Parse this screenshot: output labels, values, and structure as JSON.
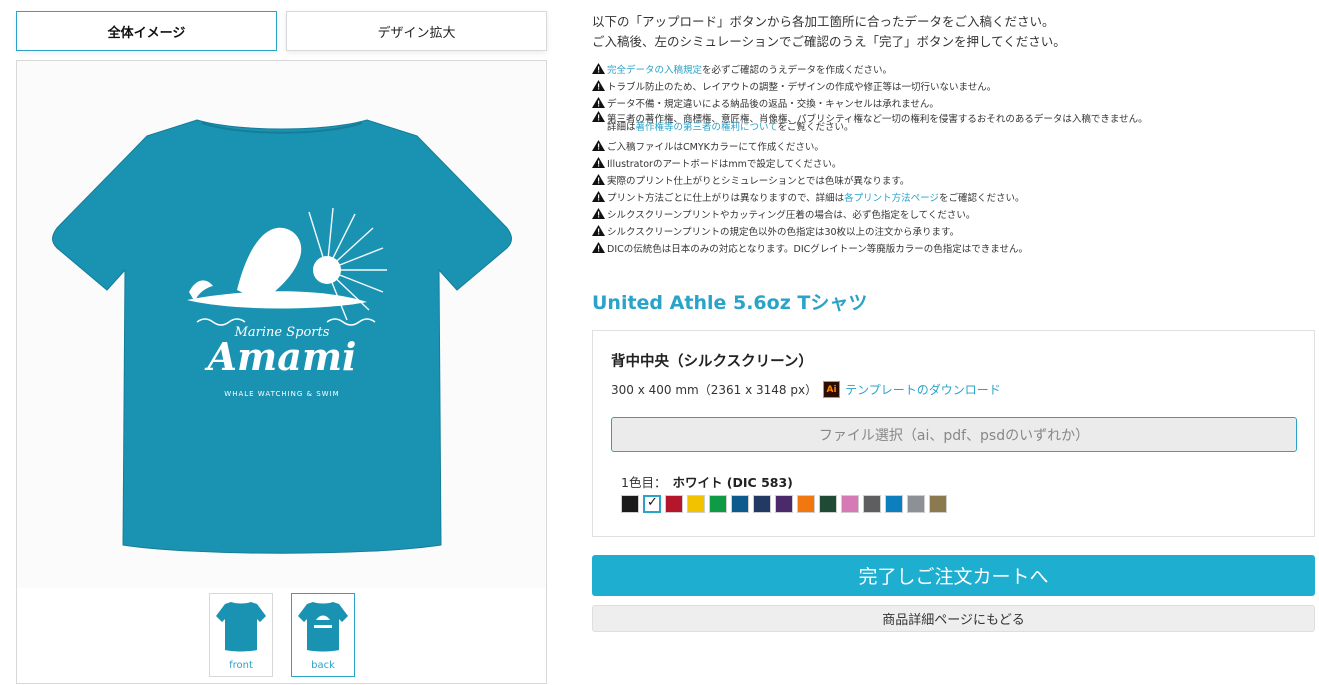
{
  "tabs": {
    "full_view": "全体イメージ",
    "design_zoom": "デザイン拡大"
  },
  "design": {
    "line1": "Marine Sports",
    "line2": "Amami",
    "line3": "WHALE WATCHING & SWIM"
  },
  "thumbnails": [
    {
      "label": "front"
    },
    {
      "label": "back"
    }
  ],
  "intro": {
    "line1": "以下の「アップロード」ボタンから各加工箇所に合ったデータをご入稿ください。",
    "line2": "ご入稿後、左のシミュレーションでご確認のうえ「完了」ボタンを押してください。"
  },
  "notes": {
    "n1_link": "完全データの入稿規定",
    "n1_text": "を必ずご確認のうえデータを作成ください。",
    "n2": "トラブル防止のため、レイアウトの調整・デザインの作成や修正等は一切行いないません。",
    "n3": "データ不備・規定違いによる納品後の返品・交換・キャンセルは承れません。",
    "n4": "第三者の著作権、商標権、意匠権、肖像権、パブリシティ権など一切の権利を侵害するおそれのあるデータは入稿できません。",
    "n4_sub_pre": "詳細は",
    "n4_sub_link": "著作権等の第三者の権利について",
    "n4_sub_post": "をご覧ください。",
    "n5": "ご入稿ファイルはCMYKカラーにて作成ください。",
    "n6": "Illustratorのアートボードはmmで設定してください。",
    "n7": "実際のプリント仕上がりとシミュレーションとでは色味が異なります。",
    "n8_pre": "プリント方法ごとに仕上がりは異なりますので、詳細は",
    "n8_link": "各プリント方法ページ",
    "n8_post": "をご確認ください。",
    "n9": "シルクスクリーンプリントやカッティング圧着の場合は、必ず色指定をしてください。",
    "n10": "シルクスクリーンプリントの規定色以外の色指定は30枚以上の注文から承ります。",
    "n11": "DICの伝統色は日本のみの対応となります。DICグレイトーン等廃版カラーの色指定はできません。"
  },
  "product": {
    "title": "United Athle 5.6oz Tシャツ",
    "tshirt_color": "#1a93b2"
  },
  "print": {
    "location": "背中中央（シルクスクリーン）",
    "size": "300 x 400 mm（2361 x 3148 px）",
    "ai_icon_text": "Ai",
    "template_link": "テンプレートのダウンロード",
    "file_button": "ファイル選択（ai、pdf、psdのいずれか）",
    "color_prefix": "1色目：",
    "color_name": "ホワイト (DIC 583)",
    "selected_check": "✓",
    "swatches": [
      "#1a1a1a",
      "#ffffff",
      "#b5162b",
      "#f2c200",
      "#0f9a46",
      "#0d5a8c",
      "#223a63",
      "#4a2a6a",
      "#f0780f",
      "#1f4a36",
      "#d57ab4",
      "#5e5e60",
      "#0d7fbf",
      "#8d9094",
      "#8b7a4f"
    ]
  },
  "actions": {
    "complete": "完了しご注文カートへ",
    "back": "商品詳細ページにもどる"
  }
}
